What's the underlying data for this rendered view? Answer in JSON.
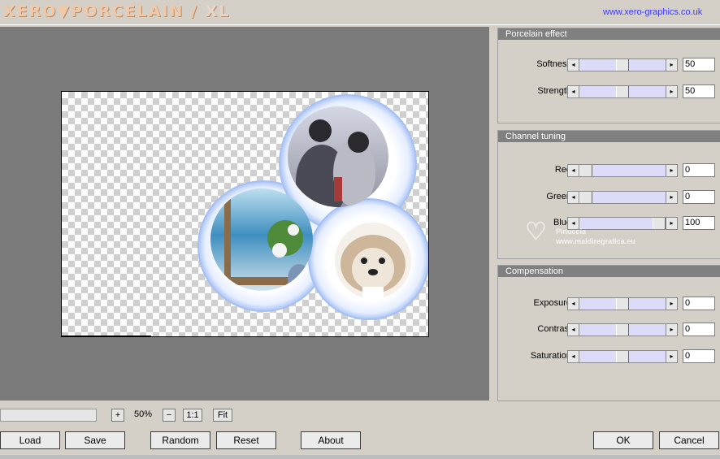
{
  "header": {
    "logo_main": "XERO▼PORCELAIN /",
    "logo_suffix": "XL",
    "website": "www.xero-graphics.co.uk"
  },
  "panels": {
    "porcelain": {
      "title": "Porcelain effect",
      "sliders": [
        {
          "label": "Softness",
          "value": "50",
          "fraction": 0.5
        },
        {
          "label": "Strength",
          "value": "50",
          "fraction": 0.5
        }
      ]
    },
    "channel": {
      "title": "Channel tuning",
      "sliders": [
        {
          "label": "Red",
          "value": "0",
          "fraction": 0.0
        },
        {
          "label": "Green",
          "value": "0",
          "fraction": 0.0
        },
        {
          "label": "Blue",
          "value": "100",
          "fraction": 1.0
        }
      ]
    },
    "compensation": {
      "title": "Compensation",
      "sliders": [
        {
          "label": "Exposure",
          "value": "0",
          "fraction": 0.5
        },
        {
          "label": "Contrast",
          "value": "0",
          "fraction": 0.5
        },
        {
          "label": "Saturation",
          "value": "0",
          "fraction": 0.5
        }
      ]
    }
  },
  "zoom": {
    "plus": "+",
    "value": "50%",
    "minus": "−",
    "one_to_one": "1:1",
    "fit": "Fit"
  },
  "buttons": {
    "load": "Load",
    "save": "Save",
    "random": "Random",
    "reset": "Reset",
    "about": "About",
    "ok": "OK",
    "cancel": "Cancel"
  },
  "watermark": {
    "line1": "Pinuccia",
    "line2": "www.maidiregrafica.eu"
  },
  "colors": {
    "preview_bg": "#7a7a7a",
    "panel_title_bg": "#808080",
    "slider_track": "#dcdcf8",
    "link": "#3a3aff"
  }
}
